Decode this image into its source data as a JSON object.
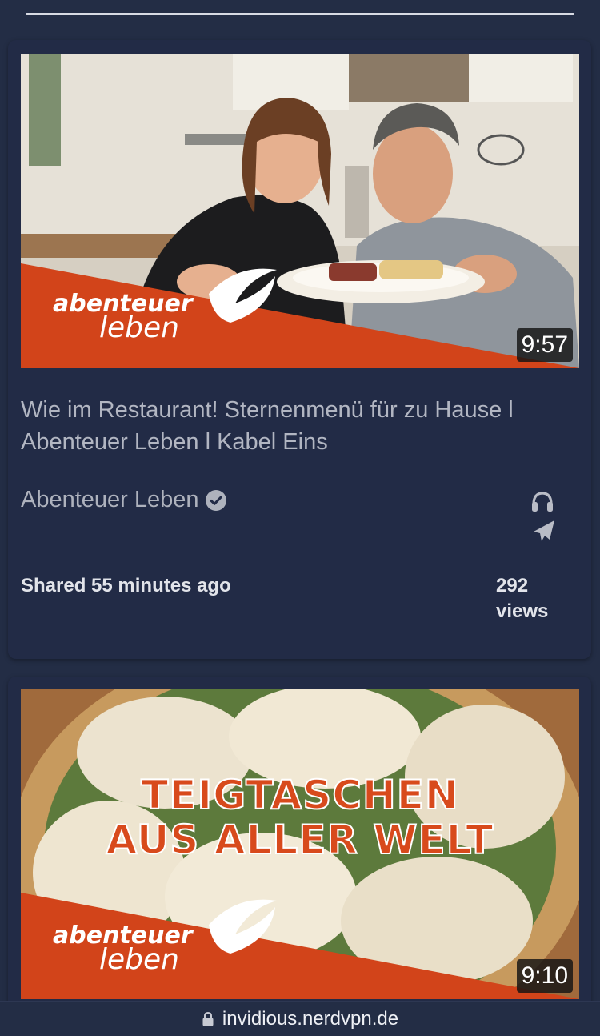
{
  "videos": [
    {
      "duration": "9:57",
      "title": "Wie im Restaurant! Sternenmenü für zu Hause l Abenteuer Leben l Kabel Eins",
      "channel": "Abenteuer Leben",
      "shared": "Shared 55 minutes ago",
      "views": "292 views",
      "brand_line1": "abenteuer",
      "brand_line2": "leben"
    },
    {
      "duration": "9:10",
      "headline_line1": "TEIGTASCHEN",
      "headline_line2": "AUS ALLER WELT",
      "brand_line1": "abenteuer",
      "brand_line2": "leben"
    }
  ],
  "browser": {
    "url": "invidious.nerdvpn.de"
  },
  "icons": {
    "verified": "check-circle-icon",
    "listen": "headphones-icon",
    "switch": "paper-plane-icon",
    "lock": "lock-icon"
  },
  "colors": {
    "background": "#232d45",
    "brand_orange": "#d2441a"
  }
}
